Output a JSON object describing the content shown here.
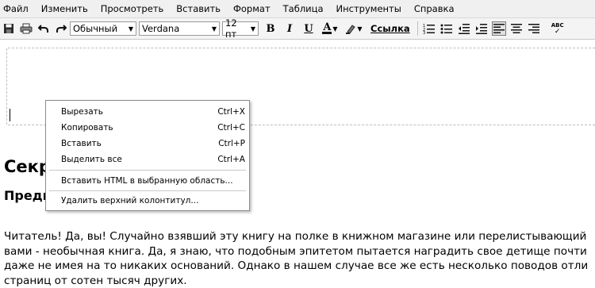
{
  "menu": [
    "Файл",
    "Изменить",
    "Просмотреть",
    "Вставить",
    "Формат",
    "Таблица",
    "Инструменты",
    "Справка"
  ],
  "toolbar": {
    "style_select": "Обычный",
    "font_select": "Verdana",
    "size_select": "12 пт",
    "bold": "B",
    "italic": "I",
    "underline": "U",
    "font_color": "A",
    "link_label": "Ссылка",
    "spell": "ABC"
  },
  "context_menu": {
    "items": [
      {
        "label": "Вырезать",
        "shortcut": "Ctrl+X"
      },
      {
        "label": "Копировать",
        "shortcut": "Ctrl+C"
      },
      {
        "label": "Вставить",
        "shortcut": "Ctrl+P"
      },
      {
        "label": "Выделить все",
        "shortcut": "Ctrl+A"
      },
      {
        "label": "Вставить HTML в выбранную область...",
        "shortcut": ""
      },
      {
        "label": "Удалить верхний колонтитул...",
        "shortcut": ""
      }
    ]
  },
  "document": {
    "heading1": "Секр",
    "heading2": "Преди",
    "paragraph_lines": [
      "Читатель! Да, вы! Случайно взявший эту книгу на полке в книжном магазине или перелистывающий",
      "вами - необычная книга. Да, я знаю, что подобным эпитетом пытается наградить свое детище почти",
      "даже не имея на то никаких оснований. Однако в нашем случае все же есть несколько поводов отли",
      "страниц от сотен тысяч других."
    ]
  }
}
